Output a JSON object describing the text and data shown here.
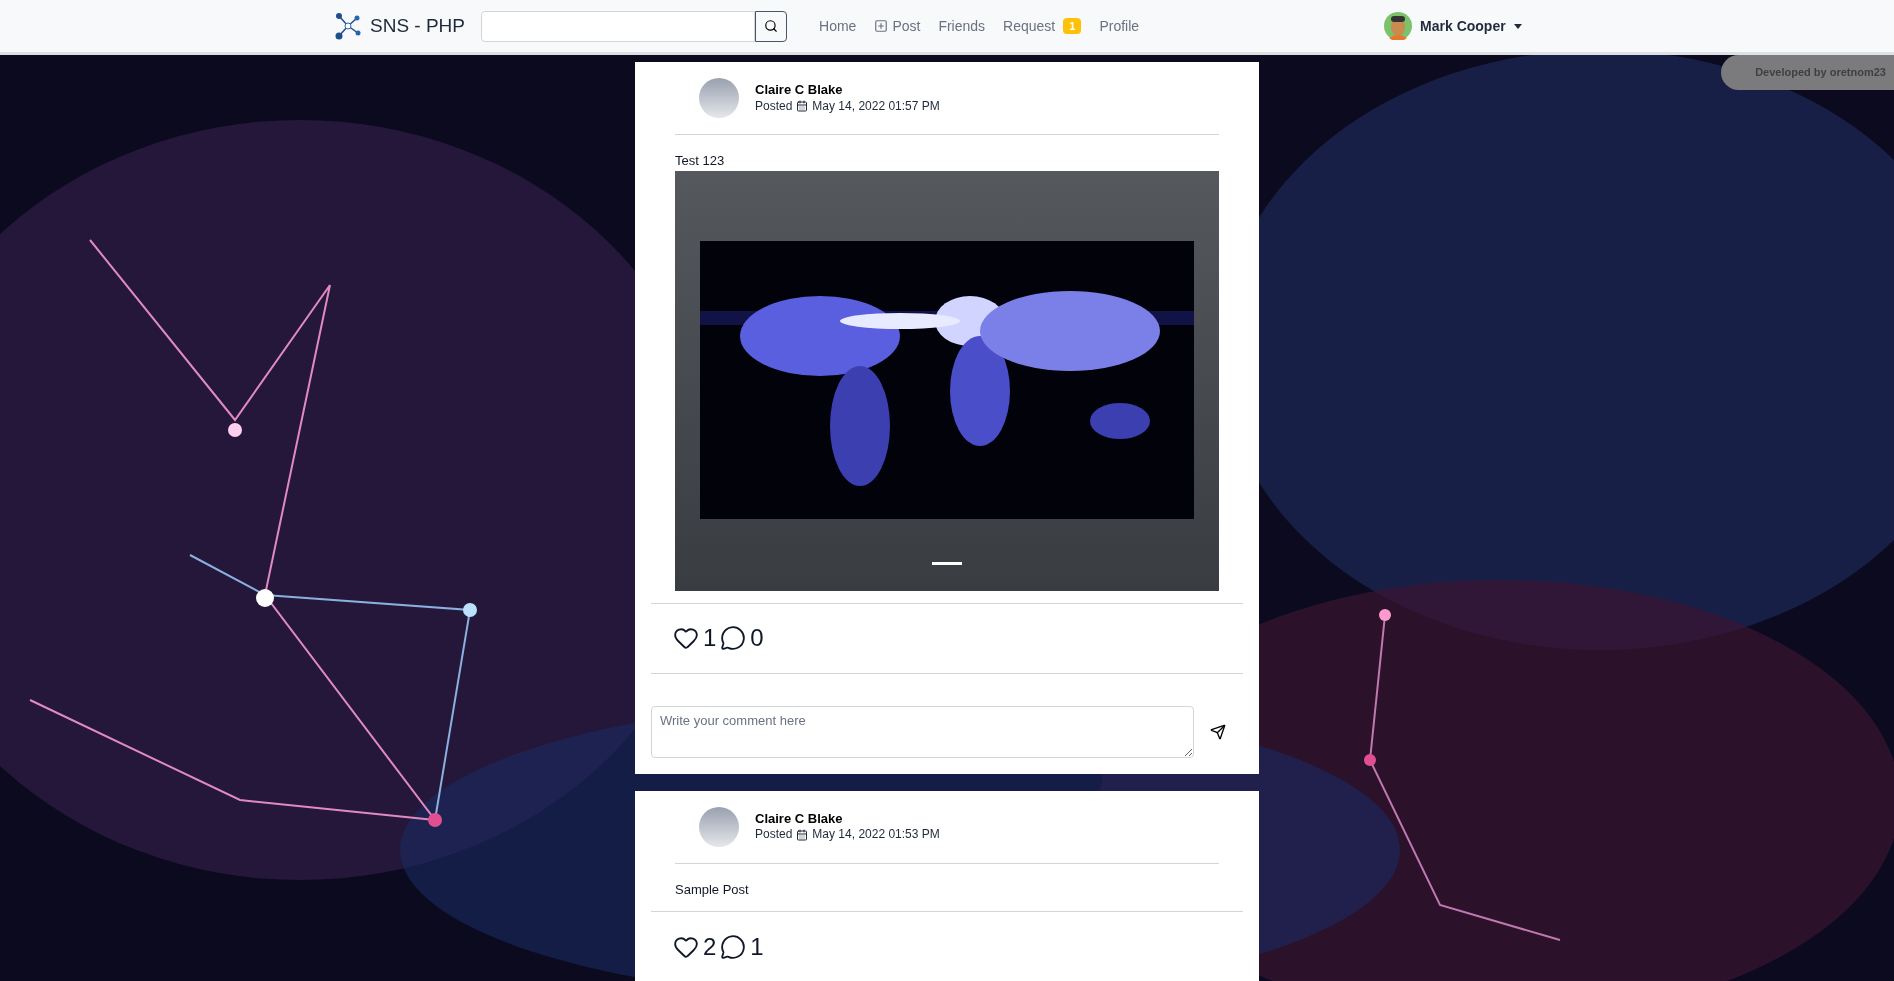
{
  "navbar": {
    "brand": "SNS - PHP",
    "links": [
      {
        "label": "Home",
        "kind": "text"
      },
      {
        "label": "Post",
        "kind": "icon"
      },
      {
        "label": "Friends",
        "kind": "text"
      },
      {
        "label": "Request",
        "kind": "badge",
        "badge": "1"
      },
      {
        "label": "Profile",
        "kind": "text"
      }
    ],
    "user": {
      "name": "Mark Cooper"
    }
  },
  "credit": "Developed by oretnom23",
  "posts": [
    {
      "author": "Claire C Blake",
      "posted_label": "Posted",
      "date": "May 14, 2022 01:57 PM",
      "text": "Test 123",
      "likes": "1",
      "comments": "0",
      "comment_placeholder": "Write your comment here"
    },
    {
      "author": "Claire C Blake",
      "posted_label": "Posted",
      "date": "May 14, 2022 01:53 PM",
      "text": "Sample Post",
      "likes": "2",
      "comments": "1"
    }
  ]
}
